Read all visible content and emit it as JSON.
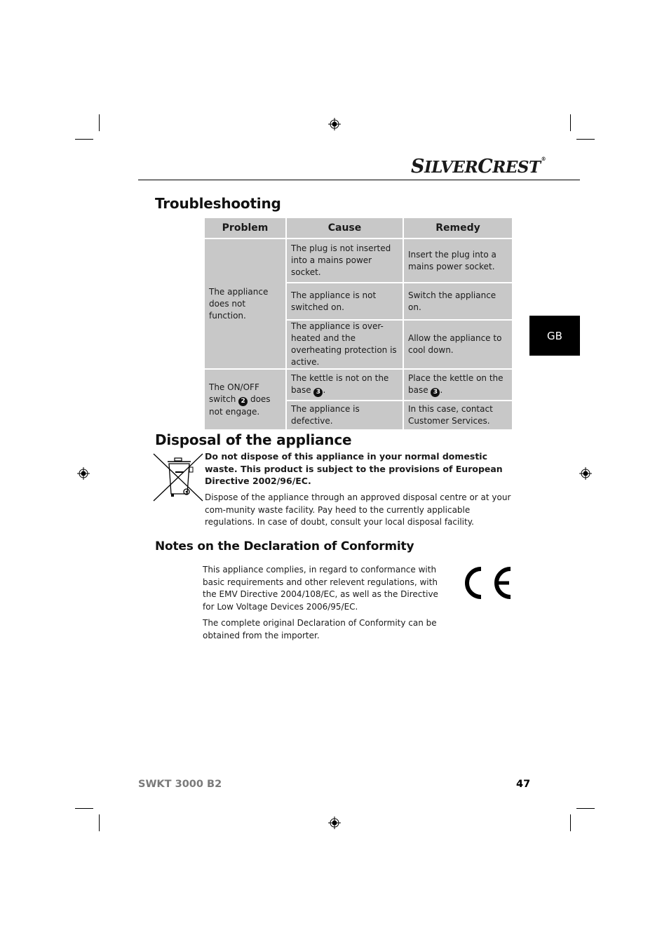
{
  "header": {
    "brand_logo": "SilverCrest",
    "brand_first_initial": "S",
    "brand_first_rest": "ILVER",
    "brand_second_initial": "C",
    "brand_second_rest": "REST",
    "registered_mark": "®"
  },
  "language_tab": "GB",
  "troubleshooting": {
    "title": "Troubleshooting",
    "columns": [
      "Problem",
      "Cause",
      "Remedy"
    ],
    "groups": [
      {
        "problem": "The appliance does not function.",
        "rows": [
          {
            "cause": "The plug is not inserted into a mains power socket.",
            "remedy": "Insert the plug into a mains power socket."
          },
          {
            "cause": "The appliance is not switched on.",
            "remedy": "Switch the appliance on."
          },
          {
            "cause": "The appliance is over-heated and the overheating protection is active.",
            "remedy": "Allow the appliance to cool down."
          }
        ]
      },
      {
        "problem_before": "The ON/OFF switch",
        "problem_ref": "2",
        "problem_after": "does not engage.",
        "rows": [
          {
            "cause_before": "The kettle is not on the base",
            "cause_ref": "3",
            "cause_after": ".",
            "remedy_before": "Place the kettle on the base",
            "remedy_ref": "3",
            "remedy_after": "."
          },
          {
            "cause": "The appliance is defective.",
            "remedy": "In this case, contact Customer Services."
          }
        ]
      }
    ]
  },
  "disposal": {
    "title": "Disposal of the appliance",
    "icon": "crossed-out-wheelie-bin-icon",
    "warning": "Do not dispose of this appliance in your normal domestic waste. This product is subject to the provisions of European Directive 2002/96/EC.",
    "body": "Dispose of the appliance through an approved disposal centre or at your com-munity waste facility. Pay heed to the currently applicable regulations. In case of doubt, consult your local disposal facility."
  },
  "conformity": {
    "title": "Notes on the Declaration of Conformity",
    "paragraph1": "This appliance complies, in regard to conformance with basic requirements and other relevent regulations, with the EMV Directive 2004/108/EC, as well as the Directive for Low Voltage Devices 2006/95/EC.",
    "paragraph2": "The complete original Declaration of Conformity can be obtained from the importer.",
    "mark": "CE"
  },
  "footer": {
    "model": "SWKT 3000 B2",
    "page_number": "47"
  }
}
